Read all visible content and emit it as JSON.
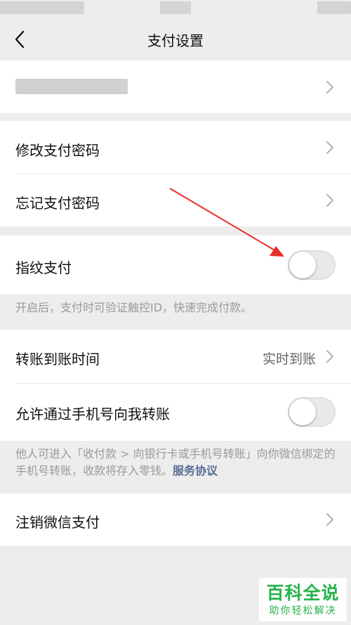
{
  "nav": {
    "title": "支付设置",
    "back_icon": "chevron-left-icon"
  },
  "account": {
    "label": ""
  },
  "password": {
    "change_label": "修改支付密码",
    "forgot_label": "忘记支付密码"
  },
  "fingerprint": {
    "label": "指纹支付",
    "enabled": false,
    "note": "开启后，支付时可验证触控ID，快速完成付款。"
  },
  "transfer": {
    "arrival_label": "转账到账时间",
    "arrival_value": "实时到账",
    "phone_label": "允许通过手机号向我转账",
    "phone_enabled": false,
    "note_text": "他人可进入「收付款 > 向银行卡或手机号转账」向你微信绑定的手机号转账，收款将存入零钱。",
    "note_link": "服务协议"
  },
  "cancel": {
    "label": "注销微信支付"
  },
  "watermark": {
    "title": "百科全说",
    "subtitle": "助你轻松解决"
  },
  "colors": {
    "background": "#ededed",
    "link": "#576b95",
    "annotation_arrow": "#e8302a",
    "watermark": "#26b34a"
  }
}
